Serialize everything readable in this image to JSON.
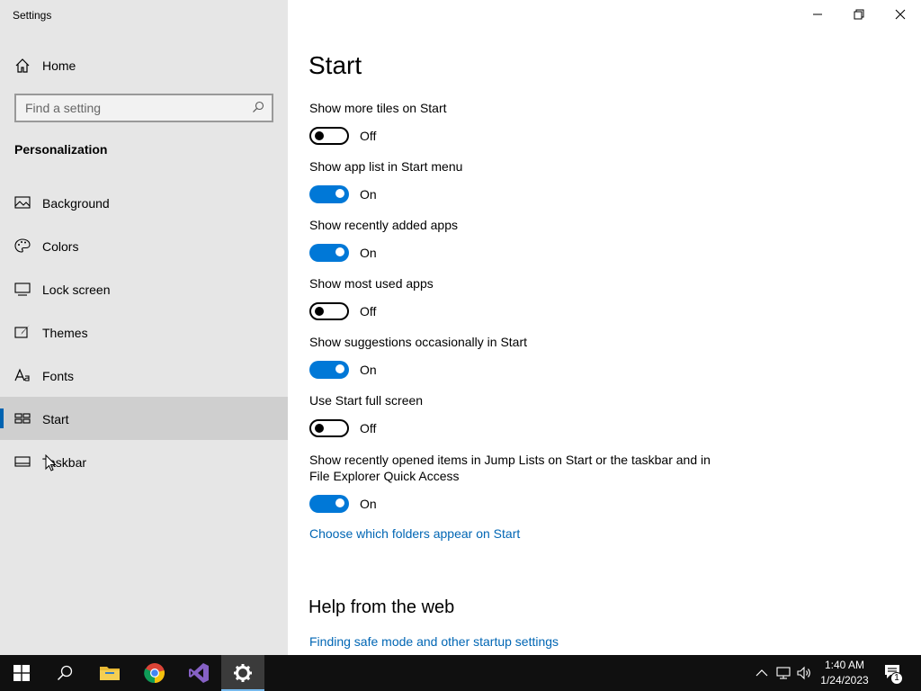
{
  "window": {
    "title": "Settings",
    "controls": [
      "minimize-icon",
      "restore-icon",
      "close-icon"
    ]
  },
  "sidebar": {
    "home_label": "Home",
    "search_placeholder": "Find a setting",
    "section_title": "Personalization",
    "items": [
      {
        "label": "Background",
        "icon": "picture-icon"
      },
      {
        "label": "Colors",
        "icon": "palette-icon"
      },
      {
        "label": "Lock screen",
        "icon": "monitor-lock-icon"
      },
      {
        "label": "Themes",
        "icon": "brush-icon"
      },
      {
        "label": "Fonts",
        "icon": "font-icon"
      },
      {
        "label": "Start",
        "icon": "start-grid-icon",
        "selected": true
      },
      {
        "label": "Taskbar",
        "icon": "taskbar-icon"
      }
    ]
  },
  "main": {
    "title": "Start",
    "settings": [
      {
        "label": "Show more tiles on Start",
        "state": "Off"
      },
      {
        "label": "Show app list in Start menu",
        "state": "On"
      },
      {
        "label": "Show recently added apps",
        "state": "On"
      },
      {
        "label": "Show most used apps",
        "state": "Off"
      },
      {
        "label": "Show suggestions occasionally in Start",
        "state": "On"
      },
      {
        "label": "Use Start full screen",
        "state": "Off"
      },
      {
        "label": "Show recently opened items in Jump Lists on Start or the taskbar and in File Explorer Quick Access",
        "state": "On"
      }
    ],
    "folders_link": "Choose which folders appear on Start",
    "help_title": "Help from the web",
    "help_link": "Finding safe mode and other startup settings"
  },
  "taskbar": {
    "apps": [
      "windows-start-icon",
      "search-icon",
      "file-explorer-icon",
      "chrome-icon",
      "visual-studio-icon",
      "settings-gear-icon"
    ],
    "active_app": "settings-gear-icon",
    "time": "1:40 AM",
    "date": "1/24/2023",
    "notification_count": "1"
  },
  "colors": {
    "accent": "#0078d7",
    "link": "#0066b4",
    "sidebar_bg": "#e6e6e6",
    "taskbar_bg": "#101010"
  }
}
